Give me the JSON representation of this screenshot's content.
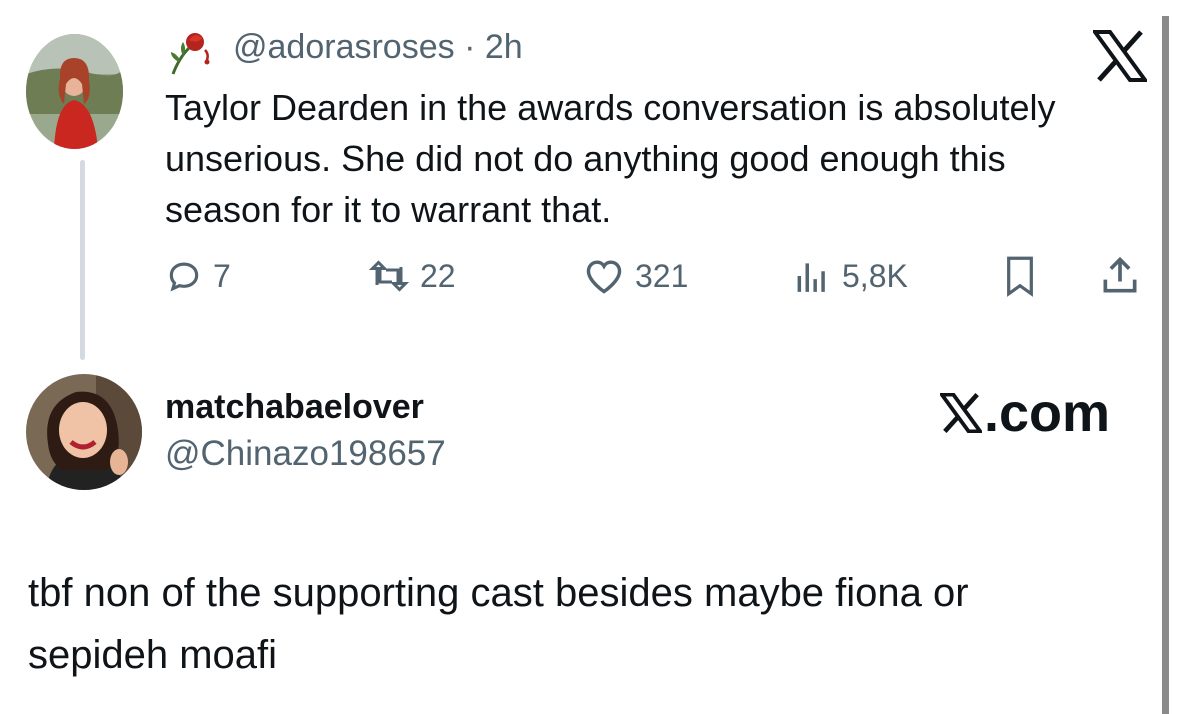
{
  "tweet": {
    "handle": "@adorasroses",
    "time": "· 2h",
    "text": "Taylor Dearden in the awards conversation is absolutely unserious. She did not do anything good enough this season for it to warrant that.",
    "actions": {
      "replies": "7",
      "retweets": "22",
      "likes": "321",
      "views": "5,8K"
    }
  },
  "reply": {
    "display_name": "matchabaelover",
    "handle": "@Chinazo198657",
    "text_line1": "tbf non of the supporting cast besides maybe fiona or",
    "text_line2": "sepideh moafi"
  },
  "branding": {
    "site_suffix": ".com"
  },
  "colors": {
    "text": "#0f1419",
    "secondary": "#536471",
    "thread_line": "#d4dadf"
  },
  "icons": [
    "rose-icon",
    "x-logo-icon",
    "reply-icon",
    "retweet-icon",
    "like-icon",
    "views-icon",
    "bookmark-icon",
    "share-icon"
  ]
}
